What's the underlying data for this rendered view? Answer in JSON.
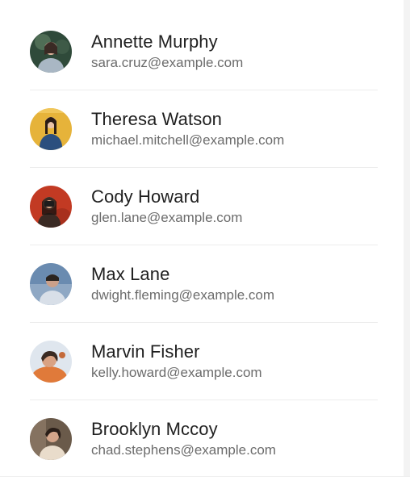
{
  "contacts": [
    {
      "name": "Annette Murphy",
      "email": "sara.cruz@example.com",
      "avatar_icon": "person-photo-icon",
      "avatar_bg": "#2f4a3a",
      "avatar_fg": "#a9b7c4"
    },
    {
      "name": "Theresa Watson",
      "email": "michael.mitchell@example.com",
      "avatar_icon": "person-photo-icon",
      "avatar_bg": "#e6b33a",
      "avatar_fg": "#2b4f7e"
    },
    {
      "name": "Cody Howard",
      "email": "glen.lane@example.com",
      "avatar_icon": "person-photo-icon",
      "avatar_bg": "#c23a23",
      "avatar_fg": "#3a2a24"
    },
    {
      "name": "Max Lane",
      "email": "dwight.fleming@example.com",
      "avatar_icon": "person-photo-icon",
      "avatar_bg": "#6a8bb0",
      "avatar_fg": "#d8dfe8"
    },
    {
      "name": "Marvin Fisher",
      "email": "kelly.howard@example.com",
      "avatar_icon": "person-photo-icon",
      "avatar_bg": "#e07a3a",
      "avatar_fg": "#3a2a22"
    },
    {
      "name": "Brooklyn Mccoy",
      "email": "chad.stephens@example.com",
      "avatar_icon": "person-photo-icon",
      "avatar_bg": "#6a5a4a",
      "avatar_fg": "#e9dccb"
    }
  ]
}
